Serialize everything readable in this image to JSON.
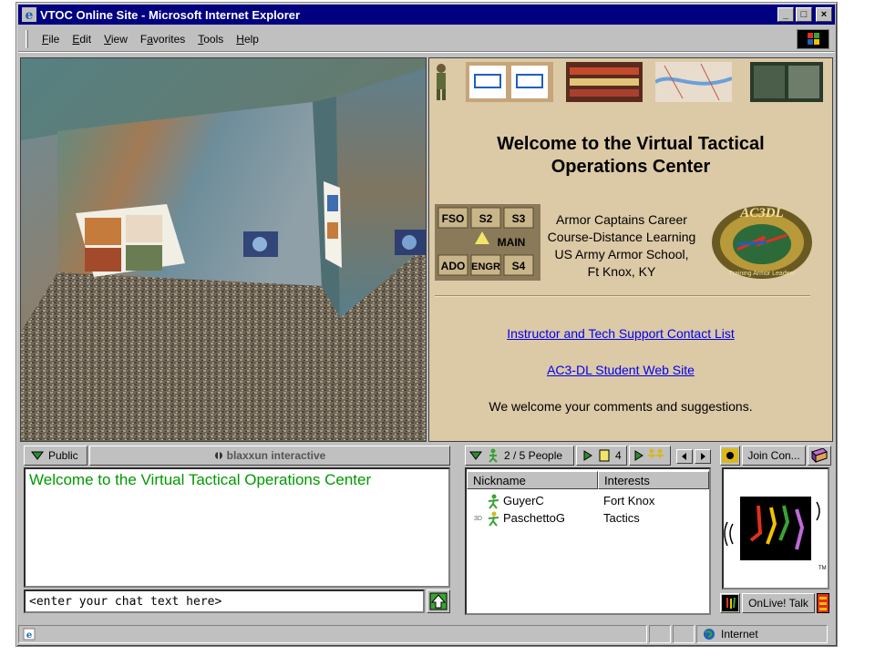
{
  "window": {
    "title": "VTOC Online Site - Microsoft Internet Explorer"
  },
  "title_controls": {
    "minimize": "_",
    "maximize": "□",
    "close": "×"
  },
  "menu": [
    {
      "label": "File",
      "key": "F",
      "rest": "ile"
    },
    {
      "label": "Edit",
      "key": "E",
      "rest": "dit"
    },
    {
      "label": "View",
      "key": "V",
      "rest": "iew"
    },
    {
      "label": "Favorites",
      "key": "a",
      "pre": "F",
      "rest": "vorites"
    },
    {
      "label": "Tools",
      "key": "T",
      "rest": "ools"
    },
    {
      "label": "Help",
      "key": "H",
      "rest": "elp"
    }
  ],
  "welcome": {
    "title": "Welcome to the Virtual Tactical Operations Center",
    "staff": {
      "top": [
        "FSO",
        "S2",
        "S3"
      ],
      "main": "MAIN",
      "bottom": [
        "ADO",
        "ENGR",
        "S4"
      ]
    },
    "center_lines": [
      "Armor Captains Career",
      "Course-Distance Learning",
      "US Army Armor School,",
      "Ft Knox, KY"
    ],
    "seal_text": "AC3DL",
    "seal_motto": "Training Armor Leaders",
    "links": [
      "Instructor and Tech Support Contact List",
      "AC3-DL Student Web Site"
    ],
    "comments": "We welcome your comments and suggestions."
  },
  "chat": {
    "tab_label": "Public",
    "brand": "blaxxun interactive",
    "log": [
      "Welcome to the Virtual Tactical Operations Center"
    ],
    "input_placeholder": "<enter your chat text here>"
  },
  "people": {
    "tab_count": "2 / 5 People",
    "tab2_count": "4",
    "columns": [
      "Nickname",
      "Interests"
    ],
    "rows": [
      {
        "prefix": "",
        "nick": "GuyerC",
        "interest": "Fort Knox"
      },
      {
        "prefix": "3D",
        "nick": "PaschettoG",
        "interest": "Tactics"
      }
    ]
  },
  "onlive": {
    "join_label": "Join Con...",
    "talk_label": "OnLive! Talk",
    "tm": "TM"
  },
  "statusbar": {
    "zone": "Internet"
  },
  "colors": {
    "titlebar": "#000080",
    "welcome_bg": "#dcc9a6",
    "chat_green": "#009900",
    "link": "#0000ee"
  }
}
